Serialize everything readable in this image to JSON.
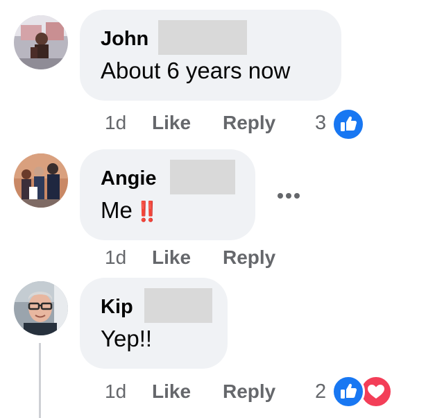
{
  "comments": [
    {
      "author": "John",
      "text": "About 6 years now",
      "time": "1d",
      "like_label": "Like",
      "reply_label": "Reply",
      "reaction_count": "3",
      "reactions": [
        "like-icon"
      ]
    },
    {
      "author": "Angie",
      "text": "Me",
      "emoji": "‼️",
      "time": "1d",
      "like_label": "Like",
      "reply_label": "Reply",
      "more_icon": "more-options-icon"
    },
    {
      "author": "Kip",
      "text": "Yep!!",
      "time": "1d",
      "like_label": "Like",
      "reply_label": "Reply",
      "reaction_count": "2",
      "reactions": [
        "like-icon",
        "love-icon"
      ]
    }
  ],
  "colors": {
    "bubble": "#f0f2f5",
    "meta_text": "#65676b",
    "like_blue": "#1877f2",
    "love_red": "#f33e58",
    "redaction": "#d9d9d9"
  }
}
